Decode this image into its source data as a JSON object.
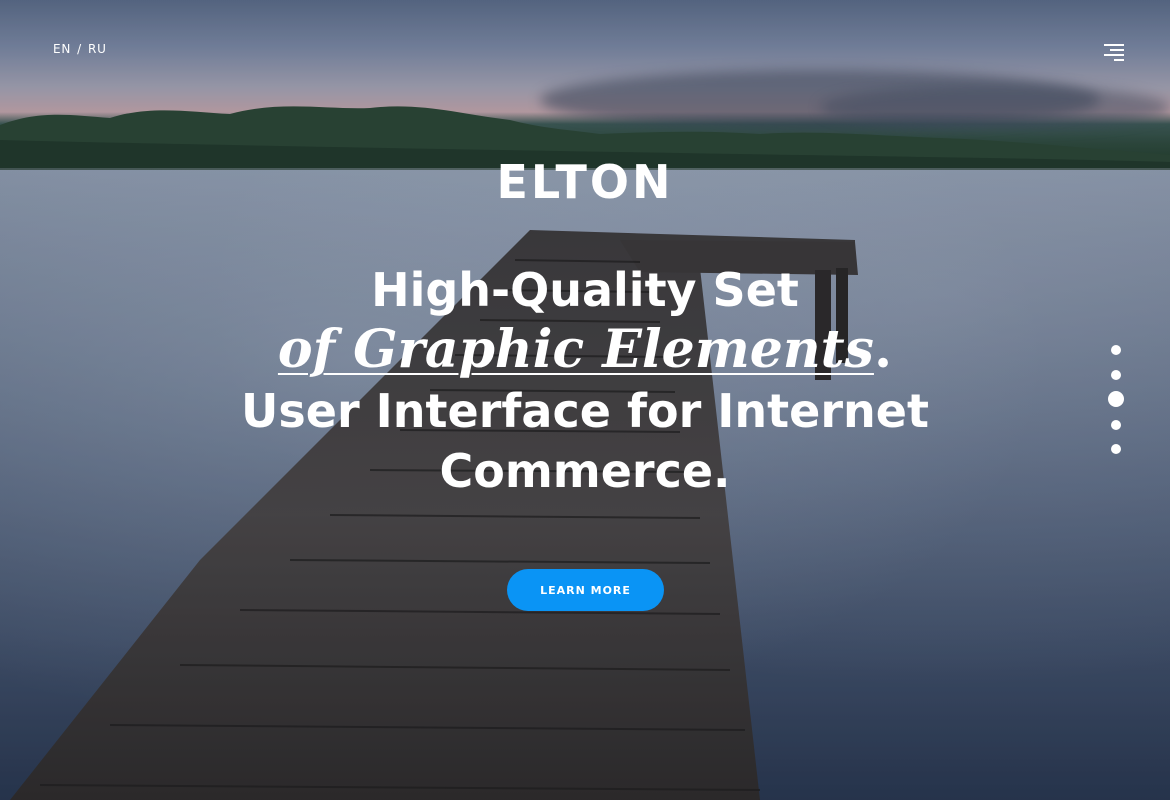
{
  "header": {
    "lang_en": "EN",
    "lang_separator": "/",
    "lang_ru": "RU",
    "menu_icon": "hamburger-menu-icon"
  },
  "hero": {
    "brand": "ELTON",
    "headline_line1": "High-Quality Set",
    "headline_italic": "of Graphic Elements",
    "headline_italic_end": ".",
    "headline_line3": "User Interface for Internet Commerce.",
    "cta_label": "LEARN MORE"
  },
  "slider": {
    "total_slides": 5,
    "active_slide": 3
  },
  "colors": {
    "accent": "#0a94f5",
    "text": "#ffffff"
  }
}
